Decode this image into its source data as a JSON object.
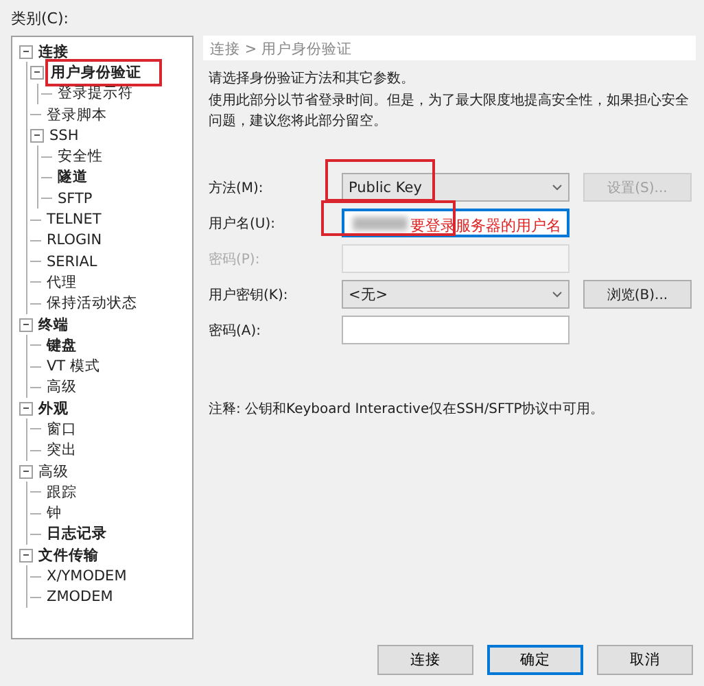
{
  "category_label": "类别(C):",
  "tree": [
    {
      "label": "连接",
      "bold": true,
      "expanded": true,
      "marked": false,
      "children": [
        {
          "label": "用户身份验证",
          "bold": true,
          "expanded": true,
          "marked": true,
          "children": [
            {
              "label": "登录提示符",
              "bold": false,
              "marked": false
            }
          ]
        },
        {
          "label": "登录脚本",
          "bold": false,
          "marked": false
        },
        {
          "label": "SSH",
          "bold": false,
          "expanded": true,
          "marked": false,
          "children": [
            {
              "label": "安全性",
              "bold": false,
              "marked": false
            },
            {
              "label": "隧道",
              "bold": true,
              "marked": false
            },
            {
              "label": "SFTP",
              "bold": false,
              "marked": false
            }
          ]
        },
        {
          "label": "TELNET",
          "bold": false,
          "marked": false
        },
        {
          "label": "RLOGIN",
          "bold": false,
          "marked": false
        },
        {
          "label": "SERIAL",
          "bold": false,
          "marked": false
        },
        {
          "label": "代理",
          "bold": false,
          "marked": false
        },
        {
          "label": "保持活动状态",
          "bold": false,
          "marked": false
        }
      ]
    },
    {
      "label": "终端",
      "bold": true,
      "expanded": true,
      "marked": false,
      "children": [
        {
          "label": "键盘",
          "bold": true,
          "marked": false
        },
        {
          "label": "VT 模式",
          "bold": false,
          "marked": false
        },
        {
          "label": "高级",
          "bold": false,
          "marked": false
        }
      ]
    },
    {
      "label": "外观",
      "bold": true,
      "expanded": true,
      "marked": false,
      "children": [
        {
          "label": "窗口",
          "bold": false,
          "marked": false
        },
        {
          "label": "突出",
          "bold": false,
          "marked": false
        }
      ]
    },
    {
      "label": "高级",
      "bold": false,
      "expanded": true,
      "marked": false,
      "children": [
        {
          "label": "跟踪",
          "bold": false,
          "marked": false
        },
        {
          "label": "钟",
          "bold": false,
          "marked": false
        },
        {
          "label": "日志记录",
          "bold": true,
          "marked": false
        }
      ]
    },
    {
      "label": "文件传输",
      "bold": true,
      "expanded": true,
      "marked": false,
      "children": [
        {
          "label": "X/YMODEM",
          "bold": false,
          "marked": false
        },
        {
          "label": "ZMODEM",
          "bold": false,
          "marked": false
        }
      ]
    }
  ],
  "breadcrumb": "连接 > 用户身份验证",
  "intro": "请选择身份验证方法和其它参数。",
  "description": "使用此部分以节省登录时间。但是，为了最大限度地提高安全性，如果担心安全问题，建议您将此部分留空。",
  "form": [
    {
      "kind": "select",
      "label": "方法(M):",
      "value": "Public Key",
      "disabled": false,
      "annotated": true,
      "button": {
        "label": "设置(S)...",
        "disabled": true
      }
    },
    {
      "kind": "text",
      "label": "用户名(U):",
      "blurred_value": true,
      "disabled": false,
      "focused": true,
      "annotated": true,
      "annotation_text": "要登录服务器的用户名"
    },
    {
      "kind": "text",
      "label": "密码(P):",
      "disabled": true,
      "focused": false
    },
    {
      "kind": "select",
      "label": "用户密钥(K):",
      "value": "<无>",
      "disabled": false,
      "button": {
        "label": "浏览(B)...",
        "disabled": false
      }
    },
    {
      "kind": "text",
      "label": "密码(A):",
      "disabled": false,
      "focused": false
    }
  ],
  "note": "注释: 公钥和Keyboard Interactive仅在SSH/SFTP协议中可用。",
  "buttons": [
    {
      "label": "连接",
      "default": false
    },
    {
      "label": "确定",
      "default": true
    },
    {
      "label": "取消",
      "default": false
    }
  ]
}
